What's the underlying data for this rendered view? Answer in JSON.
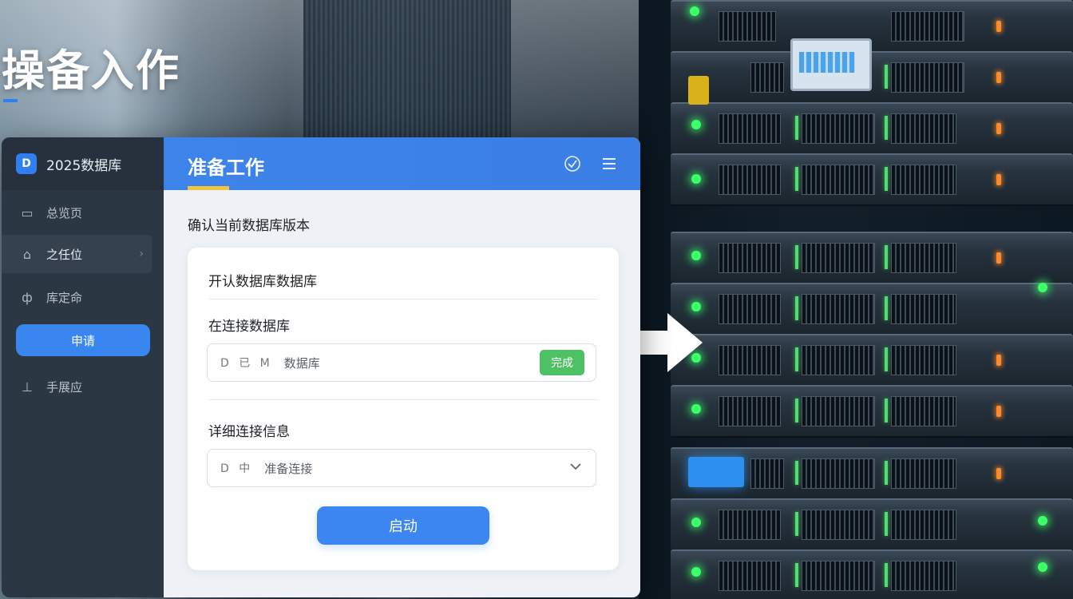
{
  "headline": "操备入作",
  "app": {
    "brand_icon": "D",
    "brand_name": "2025数据库",
    "sidebar": {
      "items": [
        {
          "label": "总览页",
          "icon": "monitor-icon"
        },
        {
          "label": "之任位",
          "icon": "home-icon",
          "active": true
        },
        {
          "label": "库定命",
          "icon": "tool-icon"
        },
        {
          "label": "手展应",
          "icon": "export-icon"
        }
      ],
      "button_label": "申请"
    },
    "topbar": {
      "title": "准备工作",
      "icons": [
        "check-badge-icon",
        "menu-icon"
      ]
    },
    "section_title": "确认当前数据库版本",
    "card": {
      "label_1": "开认数据库数据库",
      "label_2": "在连接数据库",
      "field_1": {
        "icon_text": "D 已 M",
        "text": "数据库",
        "button_label": "完成"
      },
      "label_3": "详细连接信息",
      "field_2": {
        "icon_text": "D 中",
        "text": "准备连接"
      },
      "primary_button_label": "启动"
    }
  },
  "colors": {
    "accent": "#3b86f0",
    "success": "#4fc165",
    "underline": "#f3c53a",
    "sidebar_bg": "#2c3744"
  }
}
